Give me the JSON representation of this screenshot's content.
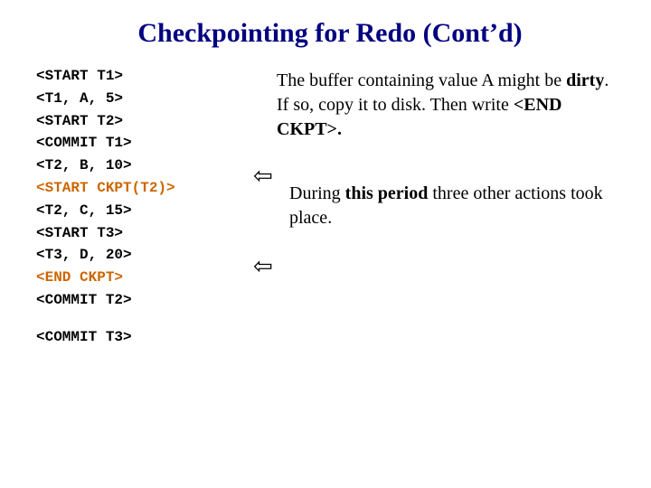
{
  "title": "Checkpointing for Redo (Cont’d)",
  "log": {
    "l1": "<START T1>",
    "l2": "<T1, A, 5>",
    "l3": "<START T2>",
    "l4": "<COMMIT T1>",
    "l5": "<T2, B, 10>",
    "l6": "<START CKPT(T2)>",
    "l7": "<T2, C, 15>",
    "l8": "<START T3>",
    "l9": "<T3, D, 20>",
    "l10": "<END CKPT>",
    "l11": "<COMMIT T2>",
    "l12": "<COMMIT T3>"
  },
  "para1": {
    "prefix": "The buffer containing value A might be ",
    "dirty": "dirty",
    "mid": ". If so, copy it to disk. Then write ",
    "endckpt": "<END CKPT>",
    "suffix": "."
  },
  "para2": {
    "prefix": "During ",
    "bold": "this period",
    "suffix": " three other actions took place."
  },
  "arrow": "⇦"
}
